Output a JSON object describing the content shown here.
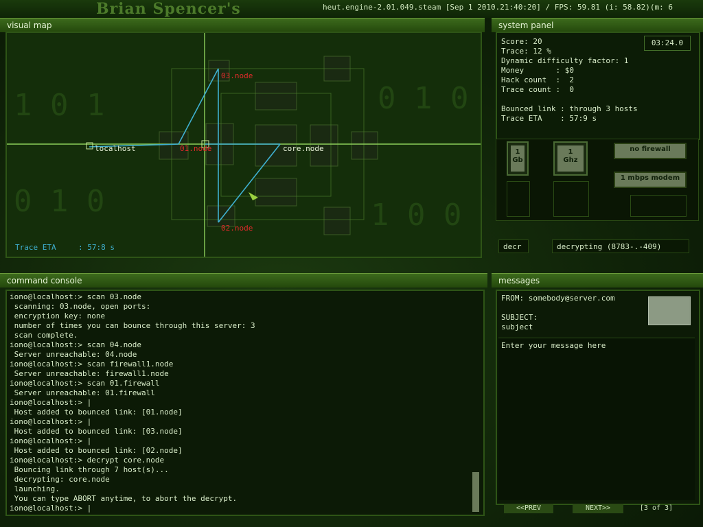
{
  "header": {
    "title": "Brian Spencer's",
    "engine_info": "heut.engine-2.01.049.steam [Sep  1 2010.21:40:20] / FPS: 59.81 (i: 58.82)(m:  6"
  },
  "visual_map": {
    "title": "visual map",
    "trace_eta_label": "Trace ETA",
    "trace_eta_value": ": 57:8 s",
    "nodes": {
      "localhost": "localhost",
      "n01": "01.node",
      "n02": "02.node",
      "n03": "03.node",
      "core": "core.node"
    }
  },
  "system_panel": {
    "title": "system panel",
    "timer": "03:24.0",
    "lines": [
      "Score: 20",
      "Trace: 12 %",
      "Dynamic difficulty factor: 1",
      "Money       : $0",
      "Hack count  :  2",
      "Trace count :  0",
      "",
      "Bounced link : through 3 hosts",
      "Trace ETA    : 57:9 s"
    ],
    "memory": "1\nGb",
    "cpu": "1\nGhz",
    "firewall": "no firewall",
    "modem": "1 mbps modem",
    "decr_label": "decr",
    "decr_status": "decrypting (8783-.-409)"
  },
  "console": {
    "title": "command console",
    "lines": [
      "iono@localhost:> scan 03.node",
      " scanning: 03.node, open ports:",
      " encryption key: none",
      " number of times you can bounce through this server: 3",
      " scan complete.",
      "iono@localhost:> scan 04.node",
      " Server unreachable: 04.node",
      "iono@localhost:> scan firewall1.node",
      " Server unreachable: firewall1.node",
      "iono@localhost:> scan 01.firewall",
      " Server unreachable: 01.firewall",
      "iono@localhost:> |",
      " Host added to bounced link: [01.node]",
      "iono@localhost:> |",
      " Host added to bounced link: [03.node]",
      "iono@localhost:> |",
      " Host added to bounced link: [02.node]",
      "iono@localhost:> decrypt core.node",
      " Bouncing link through 7 host(s)...",
      " decrypting: core.node",
      " launching.",
      " You can type ABORT anytime, to abort the decrypt.",
      "iono@localhost:> |"
    ]
  },
  "messages": {
    "title": "messages",
    "from": "FROM: somebody@server.com",
    "subject_label": "SUBJECT:",
    "subject": "subject",
    "body_placeholder": "Enter your message here",
    "prev": "<<PREV",
    "next": "NEXT>>",
    "pager": "[3 of 3]"
  },
  "colors": {
    "accent": "#3c6a1c",
    "node_label_red": "#e02a2a",
    "link_line": "#3fb0d0"
  }
}
